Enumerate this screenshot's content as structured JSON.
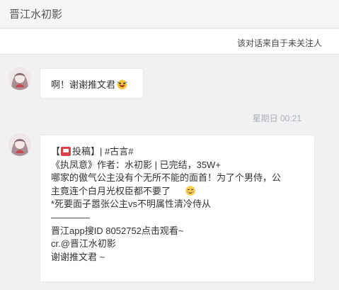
{
  "header": {
    "title": "晋江水初影"
  },
  "notice": {
    "text": "该对话来自于未关注人"
  },
  "messages": [
    {
      "text": "啊！谢谢推文君",
      "emoji": "grinning-face-emoji"
    },
    {
      "timestamp": "星期日 00:21",
      "lines": {
        "l1_pre": "【",
        "l1_post": "投稿】| #古言#",
        "l2": "《执凤意》作者：水初影 | 已完结，35W+",
        "l3": "哪家的傲气公主没有个无所不能的面首！为了个男侍，公",
        "l4": "主竟连个白月光权臣都不要了",
        "l5": "*死要面子嚣张公主vs不明属性清冷侍从",
        "l7": "晋江app搜ID 8052752点击观看~",
        "l8": "cr.@晋江水初影",
        "l9": "谢谢推文君 ~"
      },
      "icons": [
        "mailbox-icon",
        "smug-face-emoji"
      ]
    }
  ],
  "colors": {
    "background": "#f1f1f1",
    "bubble": "#ffffff",
    "timestamp": "#a8b0c0",
    "mail_icon": "#d8424a"
  }
}
